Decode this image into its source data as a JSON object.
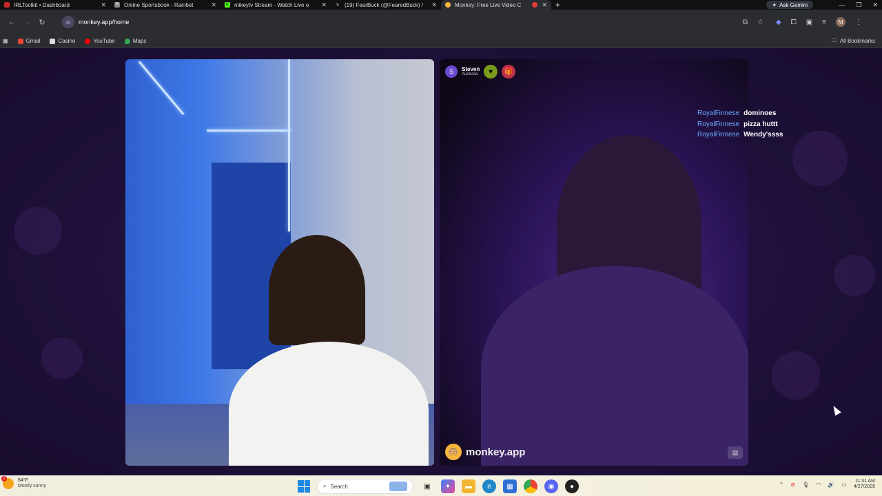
{
  "browser": {
    "tabs": [
      {
        "title": "IRLToolkit • Dashboard",
        "icon": "irltoolkit-icon",
        "color": "#c62828",
        "active": false
      },
      {
        "title": "Online Sportsbook - Rainbet",
        "icon": "rainbet-icon",
        "color": "#cccccc",
        "active": false
      },
      {
        "title": "mikeytv Stream - Watch Live o",
        "icon": "kick-icon",
        "color": "#53fc18",
        "active": false
      },
      {
        "title": "(19) FearBuck (@FearedBuck) /",
        "icon": "x-icon",
        "color": "#ffffff",
        "active": false
      },
      {
        "title": "Monkey: Free Live Video C",
        "icon": "monkey-icon",
        "color": "#f4b63a",
        "active": true
      }
    ],
    "new_tab": "+",
    "gemini_label": "Ask Gemini",
    "url": "monkey.app/home",
    "profile_initial": "M",
    "bookmarks": [
      {
        "label": "Gmail",
        "color": "#ea4335"
      },
      {
        "label": "Casino",
        "color": "#dddddd"
      },
      {
        "label": "YouTube",
        "color": "#ff0000"
      },
      {
        "label": "Maps",
        "color": "#34a853"
      }
    ],
    "all_bookmarks": "All Bookmarks"
  },
  "call": {
    "peer": {
      "initial": "S",
      "name": "Steven",
      "location": "Australia"
    },
    "chat": [
      {
        "user": "RoyalFinnese",
        "message": "dominoes"
      },
      {
        "user": "RoyalFinnese",
        "message": "pizza huttt"
      },
      {
        "user": "RoyalFinnese",
        "message": "Wendy'ssss"
      }
    ],
    "brand": "monkey.app"
  },
  "taskbar": {
    "temperature": "64°F",
    "condition": "Mostly sunny",
    "alert_count": "1",
    "search_placeholder": "Search",
    "time": "11:31 AM",
    "date": "4/27/2026"
  }
}
